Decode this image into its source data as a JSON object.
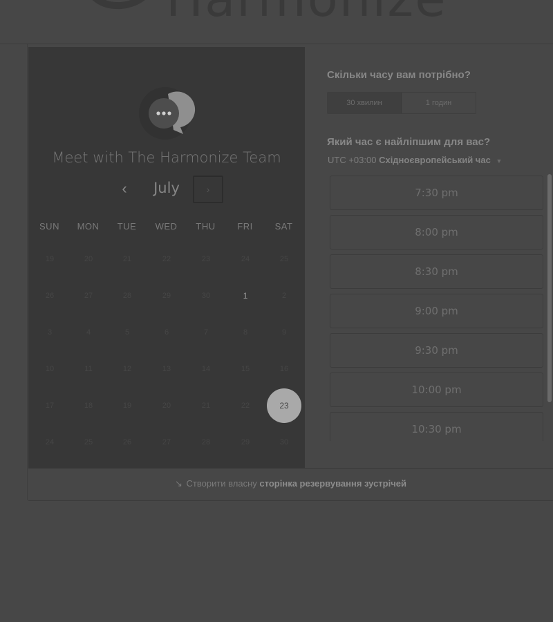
{
  "header": {
    "logo_text": "Harmonize"
  },
  "calendar": {
    "title": "Meet with The Harmonize Team",
    "month": "July",
    "prev_icon": "‹",
    "next_icon": "›",
    "weekdays": [
      "SUN",
      "MON",
      "TUE",
      "WED",
      "THU",
      "FRI",
      "SAT"
    ],
    "weeks": [
      [
        "19",
        "20",
        "21",
        "22",
        "23",
        "24",
        "25"
      ],
      [
        "26",
        "27",
        "28",
        "29",
        "30",
        "1",
        "2"
      ],
      [
        "3",
        "4",
        "5",
        "6",
        "7",
        "8",
        "9"
      ],
      [
        "10",
        "11",
        "12",
        "13",
        "14",
        "15",
        "16"
      ],
      [
        "17",
        "18",
        "19",
        "20",
        "21",
        "22",
        "23"
      ],
      [
        "24",
        "25",
        "26",
        "27",
        "28",
        "29",
        "30"
      ]
    ],
    "available_day": "1",
    "selected_day": "23"
  },
  "duration": {
    "question": "Скільки часу вам потрібно?",
    "options": [
      "30 хвилин",
      "1 годин"
    ],
    "selected": "30 хвилин"
  },
  "time": {
    "question": "Який час є найліпшим для вас?",
    "tz_offset": "UTC +03:00",
    "tz_name": "Східноєвропейський час",
    "slots": [
      "7:30 pm",
      "8:00 pm",
      "8:30 pm",
      "9:00 pm",
      "9:30 pm",
      "10:00 pm",
      "10:30 pm"
    ]
  },
  "footer": {
    "text": "Створити власну",
    "link": "сторінка резервування зустрічей"
  },
  "colors": {
    "background": "#474747",
    "panel": "#373737",
    "selected_day": "#a9a9a9"
  }
}
